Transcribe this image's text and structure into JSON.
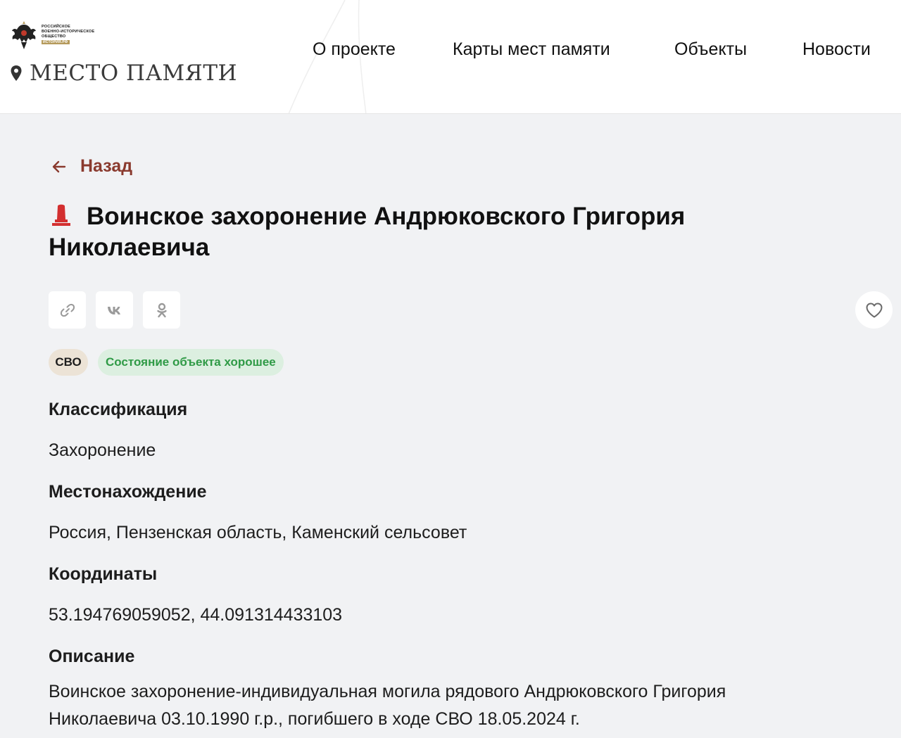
{
  "brand": {
    "org_lines": [
      "РОССИЙСКОЕ",
      "ВОЕННО-ИСТОРИЧЕСКОЕ",
      "ОБЩЕСТВО"
    ],
    "org_tag": "ИСТОРИЯ.РФ",
    "site_name": "МЕСТО ПАМЯТИ",
    "accent": "#8a3a2e"
  },
  "nav": {
    "items": [
      "О проекте",
      "Карты мест памяти",
      "Объекты",
      "Новости"
    ]
  },
  "back": {
    "label": "Назад"
  },
  "object": {
    "title": "Воинское захоронение Андрюковского Григория Николаевича",
    "tags": {
      "category": "СВО",
      "state": "Состояние объекта хорошее"
    },
    "share_icons": [
      "link-icon",
      "vk-icon",
      "ok-icon"
    ],
    "sections": [
      {
        "label": "Классификация",
        "value": "Захоронение"
      },
      {
        "label": "Местонахождение",
        "value": "Россия, Пензенская область, Каменский сельсовет"
      },
      {
        "label": "Координаты",
        "value": "53.194769059052, 44.091314433103"
      },
      {
        "label": "Описание",
        "value": "Воинское захоронение-индивидуальная могила рядового Андрюковского Григория Николаевича 03.10.1990 г.р., погибшего в ходе СВО 18.05.2024 г."
      }
    ]
  }
}
